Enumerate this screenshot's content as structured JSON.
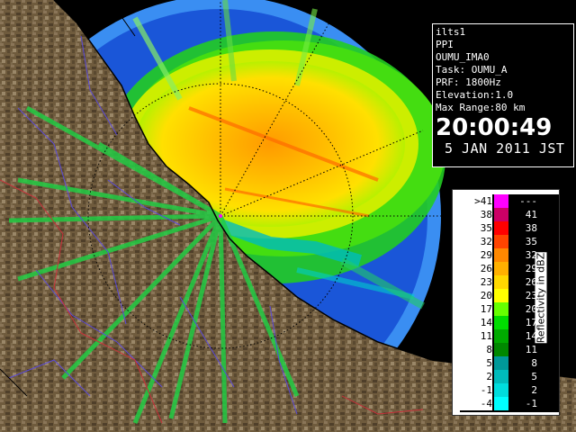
{
  "info": {
    "lines": [
      "ilts1",
      "PPI",
      "OUMU_IMA0",
      "Task: OUMU_A",
      "PRF: 1800Hz",
      "Elevation:1.0",
      "Max Range:80 km"
    ],
    "time": "20:00:49",
    "date": "5 JAN 2011 JST"
  },
  "legend": {
    "unit_label": "Reflectivity in dBZ",
    "rows": [
      {
        "left": ">41",
        "right": "---",
        "color": "#ff00ff"
      },
      {
        "left": "38",
        "right": "41",
        "color": "#cc0066"
      },
      {
        "left": "35",
        "right": "38",
        "color": "#ff0000"
      },
      {
        "left": "32",
        "right": "35",
        "color": "#ff4400"
      },
      {
        "left": "29",
        "right": "32",
        "color": "#ff8800"
      },
      {
        "left": "26",
        "right": "29",
        "color": "#ffb000"
      },
      {
        "left": "23",
        "right": "26",
        "color": "#ffd800"
      },
      {
        "left": "20",
        "right": "23",
        "color": "#ffff00"
      },
      {
        "left": "17",
        "right": "20",
        "color": "#66ff00"
      },
      {
        "left": "14",
        "right": "17",
        "color": "#00dd00"
      },
      {
        "left": "11",
        "right": "14",
        "color": "#00aa00"
      },
      {
        "left": "8",
        "right": "11",
        "color": "#008800"
      },
      {
        "left": "5",
        "right": "8",
        "color": "#009999"
      },
      {
        "left": "2",
        "right": "5",
        "color": "#00bbbb"
      },
      {
        "left": "-1",
        "right": "2",
        "color": "#00dddd"
      },
      {
        "left": "-4",
        "right": "-1",
        "color": "#00ffff"
      }
    ]
  },
  "colors": {
    "ocean": "#1a56d8",
    "outer_ring": "#3a8ef2",
    "land": "#6e5a3c",
    "river": "#5a4ad8",
    "border": "#c8303a",
    "range_ring": "#000000"
  }
}
